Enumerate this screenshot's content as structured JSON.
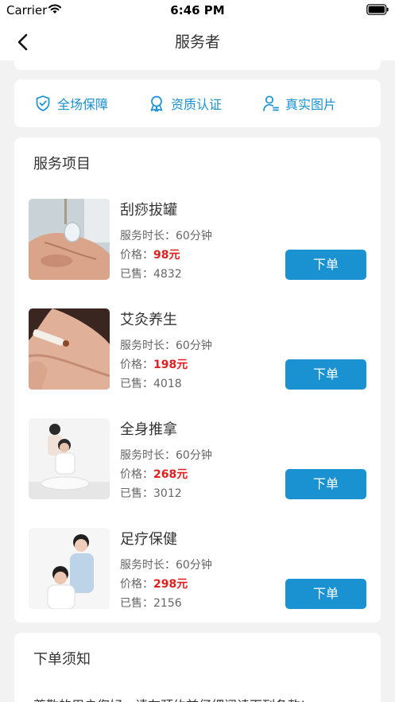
{
  "status_bar": {
    "carrier": "Carrier",
    "time": "6:46 PM",
    "wifi_icon": "wifi-icon",
    "battery_icon": "battery-icon"
  },
  "nav": {
    "title": "服务者",
    "back_icon": "chevron-left-icon"
  },
  "guarantees": [
    {
      "label": "全场保障",
      "icon": "shield-check-icon"
    },
    {
      "label": "资质认证",
      "icon": "award-badge-icon"
    },
    {
      "label": "真实图片",
      "icon": "user-verified-icon"
    }
  ],
  "services": {
    "title": "服务项目",
    "duration_prefix": "服务时长：",
    "price_prefix": "价格：",
    "sold_prefix": "已售：",
    "order_label": "下单",
    "items": [
      {
        "name": "刮痧拔罐",
        "duration": "60分钟",
        "price": "98元",
        "sold": "4832",
        "image": "cupping-therapy-photo"
      },
      {
        "name": "艾灸养生",
        "duration": "60分钟",
        "price": "198元",
        "sold": "4018",
        "image": "moxibustion-photo"
      },
      {
        "name": "全身推拿",
        "duration": "60分钟",
        "price": "268元",
        "sold": "3012",
        "image": "full-body-massage-photo"
      },
      {
        "name": "足疗保健",
        "duration": "60分钟",
        "price": "298元",
        "sold": "2156",
        "image": "foot-massage-photo"
      }
    ]
  },
  "notice": {
    "title": "下单须知",
    "text": "尊敬的用户您好，请在预约前仔细阅读下列条款!"
  },
  "colors": {
    "accent": "#1a91d0",
    "price": "#e02020",
    "background": "#f2f2f2"
  }
}
